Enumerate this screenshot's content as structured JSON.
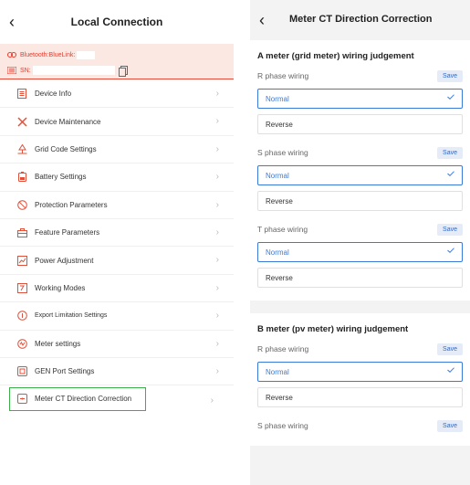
{
  "left": {
    "title": "Local Connection",
    "bluetooth_label": "Bluetooth:BlueLink:",
    "sn_label": "SN:",
    "menu": [
      {
        "label": "Device Info",
        "icon": "device-info-icon"
      },
      {
        "label": "Device Maintenance",
        "icon": "tools-icon"
      },
      {
        "label": "Grid Code Settings",
        "icon": "grid-code-icon"
      },
      {
        "label": "Battery Settings",
        "icon": "battery-icon"
      },
      {
        "label": "Protection Parameters",
        "icon": "protection-icon"
      },
      {
        "label": "Feature Parameters",
        "icon": "feature-icon"
      },
      {
        "label": "Power Adjustment",
        "icon": "power-adjust-icon"
      },
      {
        "label": "Working Modes",
        "icon": "working-mode-icon"
      },
      {
        "label": "Export Limitation Settings",
        "icon": "export-limit-icon"
      },
      {
        "label": "Meter settings",
        "icon": "meter-icon"
      },
      {
        "label": "GEN Port Settings",
        "icon": "gen-port-icon"
      },
      {
        "label": "Meter CT Direction Correction",
        "icon": "meter-ct-icon"
      }
    ]
  },
  "right": {
    "title": "Meter CT Direction Correction",
    "save_label": "Save",
    "normal_label": "Normal",
    "reverse_label": "Reverse",
    "section_a_title": "A meter (grid meter) wiring judgement",
    "section_b_title": "B meter (pv meter) wiring judgement",
    "phase_r": "R phase wiring",
    "phase_s": "S phase wiring",
    "phase_t": "T phase wiring"
  },
  "colors": {
    "accent_red": "#e63b2e",
    "accent_blue": "#3a7ad8",
    "selected_outline": "#3cb04a"
  }
}
